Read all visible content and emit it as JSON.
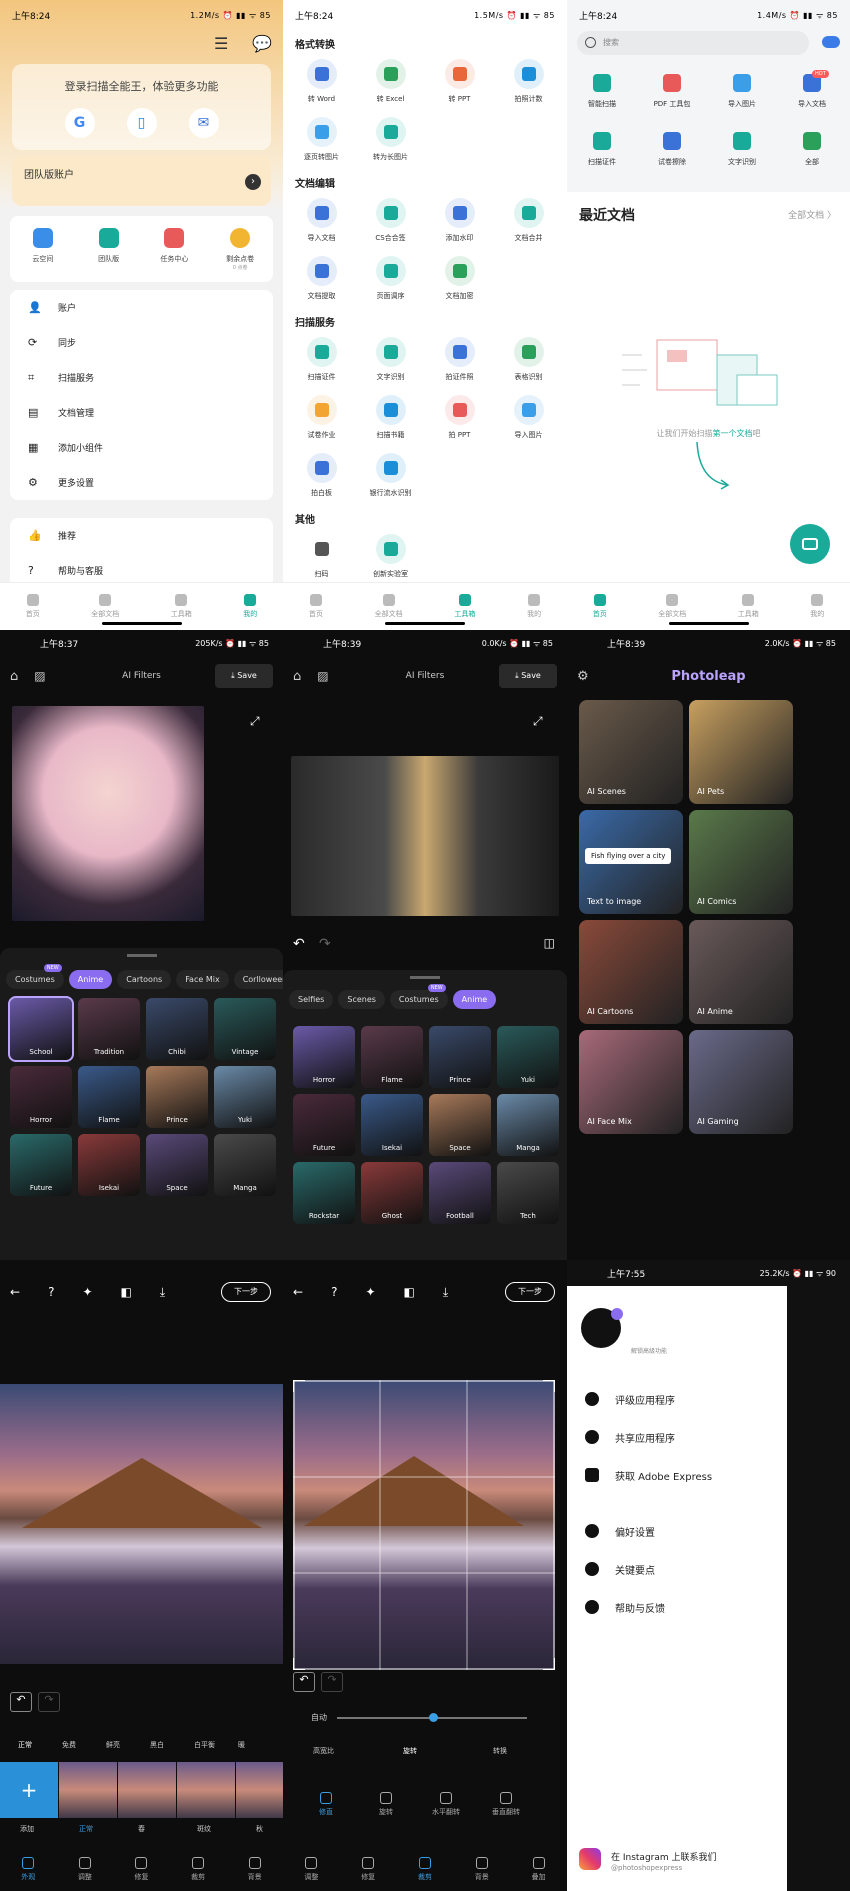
{
  "a": {
    "time": "上午8:24",
    "status": "1.2M/s ⏰ ▮▮ ᯤ 85",
    "login_title": "登录扫描全能王，体验更多功能",
    "team": "团队版账户",
    "quick": [
      {
        "label": "云空间",
        "color": "#3a8ee8"
      },
      {
        "label": "团队版",
        "color": "#1aaa9a"
      },
      {
        "label": "任务中心",
        "color": "#e85a5a"
      },
      {
        "label": "剩余点卷",
        "sub": "0 点卷",
        "color": "#f2b531"
      }
    ],
    "menu": [
      "账户",
      "同步",
      "扫描服务",
      "文档管理",
      "添加小组件",
      "更多设置"
    ],
    "menu2": [
      "推荐",
      "帮助与客服"
    ],
    "tabs": [
      "首页",
      "全部文档",
      "工具箱",
      "我的"
    ]
  },
  "b": {
    "time": "上午8:24",
    "status": "1.5M/s ⏰ ▮▮ ᯤ 85",
    "sections": [
      {
        "title": "格式转换",
        "items": [
          {
            "label": "转 Word",
            "c": "#3a72d8"
          },
          {
            "label": "转 Excel",
            "c": "#2aa05a"
          },
          {
            "label": "转 PPT",
            "c": "#e8663a"
          },
          {
            "label": "拍照计数",
            "c": "#1a8ed8"
          },
          {
            "label": "逐页转图片",
            "c": "#3a9ee8"
          },
          {
            "label": "转为长图片",
            "c": "#1aaa9a"
          }
        ]
      },
      {
        "title": "文档编辑",
        "items": [
          {
            "label": "导入文档",
            "c": "#3a72d8"
          },
          {
            "label": "CS合合签",
            "c": "#1aaa9a"
          },
          {
            "label": "添加水印",
            "c": "#3a72d8"
          },
          {
            "label": "文档合并",
            "c": "#1aaa9a"
          },
          {
            "label": "文档提取",
            "c": "#3a72d8"
          },
          {
            "label": "页面调序",
            "c": "#1aaa9a"
          },
          {
            "label": "文档加密",
            "c": "#2aa05a"
          }
        ]
      },
      {
        "title": "扫描服务",
        "items": [
          {
            "label": "扫描证件",
            "c": "#1aaa9a"
          },
          {
            "label": "文字识别",
            "c": "#1aaa9a"
          },
          {
            "label": "拍证件照",
            "c": "#3a72d8"
          },
          {
            "label": "表格识别",
            "c": "#2aa05a"
          },
          {
            "label": "试卷作业",
            "c": "#f2a531"
          },
          {
            "label": "扫描书籍",
            "c": "#1a8ed8"
          },
          {
            "label": "拍 PPT",
            "c": "#e85a5a"
          },
          {
            "label": "导入图片",
            "c": "#3a9ee8"
          },
          {
            "label": "拍白板",
            "c": "#3a72d8"
          },
          {
            "label": "银行流水识别",
            "c": "#1a8ed8"
          }
        ]
      },
      {
        "title": "其他",
        "items": [
          {
            "label": "扫码",
            "c": "#555"
          },
          {
            "label": "创新实验室",
            "c": "#1aaa9a"
          }
        ]
      }
    ],
    "tabs": [
      "首页",
      "全部文档",
      "工具箱",
      "我的"
    ]
  },
  "c": {
    "time": "上午8:24",
    "status": "1.4M/s ⏰ ▮▮ ᯤ 85",
    "search": "搜索",
    "tools": [
      {
        "label": "智能扫描",
        "c": "#1aaa9a"
      },
      {
        "label": "PDF 工具包",
        "c": "#e85a5a"
      },
      {
        "label": "导入图片",
        "c": "#3a9ee8"
      },
      {
        "label": "导入文档",
        "c": "#3a72d8"
      },
      {
        "label": "扫描证件",
        "c": "#1aaa9a"
      },
      {
        "label": "试卷擦除",
        "c": "#3a72d8"
      },
      {
        "label": "文字识别",
        "c": "#1aaa9a"
      },
      {
        "label": "全部",
        "c": "#2aa05a"
      }
    ],
    "hot": "HOT",
    "recent": "最近文档",
    "all": "全部文档 〉",
    "empty_a": "让我们开始扫描",
    "empty_b": "第一个文档",
    "empty_c": "吧",
    "tabs": [
      "首页",
      "全部文档",
      "工具箱",
      "我的"
    ]
  },
  "d": {
    "time": "上午8:37",
    "status": "205K/s ⏰ ▮▮ ᯤ 85",
    "title": "AI Filters",
    "save": "Save",
    "chips": [
      "Costumes",
      "Anime",
      "Cartoons",
      "Face Mix",
      "Corlloween 🎃"
    ],
    "new": "NEW",
    "thumbs": [
      "School",
      "Tradition",
      "Chibi",
      "Vintage",
      "Horror",
      "Flame",
      "Prince",
      "Yuki",
      "Future",
      "Isekai",
      "Space",
      "Manga"
    ]
  },
  "e": {
    "time": "上午8:39",
    "status": "0.0K/s ⏰ ▮▮ ᯤ 85",
    "title": "AI Filters",
    "save": "Save",
    "chips": [
      "Selfies",
      "Scenes",
      "Costumes",
      "Anime"
    ],
    "new": "NEW",
    "thumbs": [
      "Horror",
      "Flame",
      "Prince",
      "Yuki",
      "Future",
      "Isekai",
      "Space",
      "Manga",
      "Rockstar",
      "Ghost",
      "Football",
      "Tech"
    ]
  },
  "f": {
    "time": "上午8:39",
    "status": "2.0K/s ⏰ ▮▮ ᯤ 85",
    "title": "Photoleap",
    "cards": [
      "AI Scenes",
      "AI Pets",
      "Text to image",
      "AI Comics",
      "AI Cartoons",
      "AI Anime",
      "AI Face Mix",
      "AI Gaming"
    ],
    "prompt": "Fish flying over a city"
  },
  "g": {
    "next": "下一步",
    "filters": [
      "正常",
      "免费",
      "鲜亮",
      "黑白",
      "白平衡",
      "暖"
    ],
    "thumbs": [
      "添加",
      "正常",
      "春",
      "斑纹",
      "秋"
    ],
    "tabs": [
      "外观",
      "调整",
      "修复",
      "裁剪",
      "背景"
    ]
  },
  "h": {
    "next": "下一步",
    "auto": "自动",
    "modes": [
      "高宽比",
      "旋转",
      "转换"
    ],
    "actions": [
      "修直",
      "旋转",
      "水平翻转",
      "垂直翻转"
    ],
    "tabs": [
      "调整",
      "修复",
      "裁剪",
      "背景",
      "叠加"
    ]
  },
  "i": {
    "time": "上午7:55",
    "status": "25.2K/s ⏰ ▮▮ ᯤ 90",
    "sub": "解锁高级功能",
    "menu": [
      "评级应用程序",
      "共享应用程序",
      "获取 Adobe Express"
    ],
    "menu2": [
      "偏好设置",
      "关键要点",
      "帮助与反馈"
    ],
    "insta": "在 Instagram 上联系我们",
    "handle": "@photoshopexpress"
  }
}
